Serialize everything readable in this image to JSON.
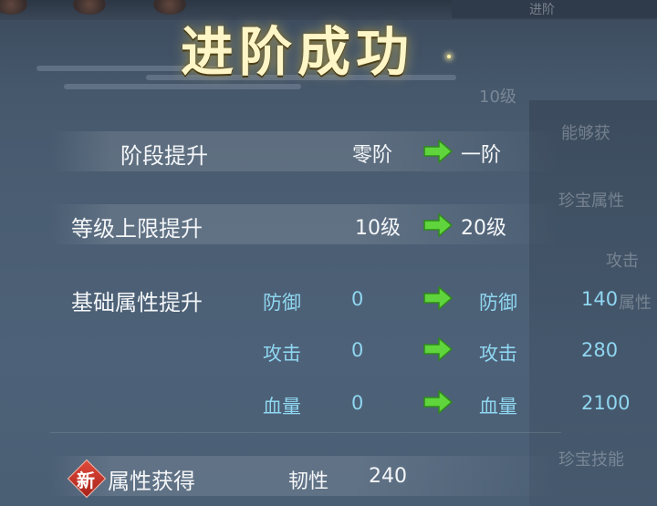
{
  "title": "进阶成功",
  "background": {
    "tab_text": "进阶",
    "ghost_texts": [
      "10级",
      "能够获",
      "珍宝属性",
      "攻击",
      "属性",
      "珍宝技能"
    ]
  },
  "rows": {
    "stage": {
      "label": "阶段提升",
      "from": "零阶",
      "to": "一阶"
    },
    "level_cap": {
      "label": "等级上限提升",
      "from": "10级",
      "to": "20级"
    },
    "base_attr": {
      "label": "基础属性提升",
      "items": [
        {
          "name_from": "防御",
          "from": "0",
          "name_to": "防御",
          "to": "140"
        },
        {
          "name_from": "攻击",
          "from": "0",
          "name_to": "攻击",
          "to": "280"
        },
        {
          "name_from": "血量",
          "from": "0",
          "name_to": "血量",
          "to": "2100"
        }
      ]
    },
    "attr_gain": {
      "badge": "新",
      "label": "属性获得",
      "attr_name": "韧性",
      "attr_value": "240"
    }
  },
  "icons": {
    "arrow": "green-right-arrow-icon",
    "badge": "new-badge-icon"
  },
  "colors": {
    "arrow_green": "#5fd43c",
    "attr_cyan": "#8fd6f0",
    "title_gold": "#fff6c8",
    "badge_red": "#d0392b"
  }
}
